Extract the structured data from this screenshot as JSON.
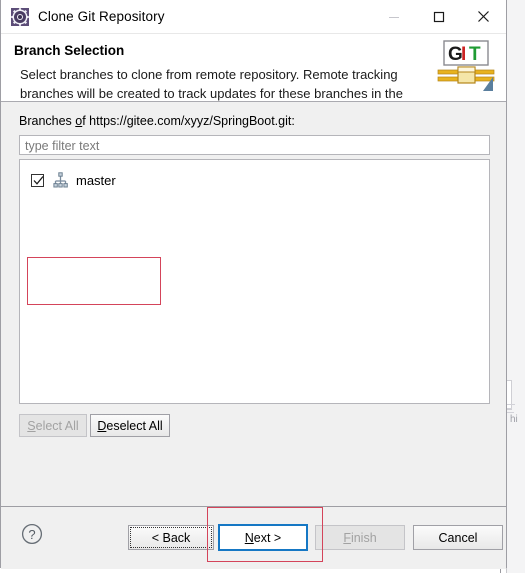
{
  "window": {
    "title": "Clone Git Repository",
    "app_icon": "gear-circle-icon",
    "controls": {
      "minimize": "minimize-icon",
      "maximize": "maximize-icon",
      "close": "close-icon"
    }
  },
  "header": {
    "title": "Branch Selection",
    "description": "Select branches to clone from remote repository. Remote tracking branches will be created to track updates for these branches in the",
    "logo": {
      "letters": [
        "G",
        "I",
        "T"
      ],
      "colors": {
        "g": "#1a1a1a",
        "i": "#cc2222",
        "t": "#1f9b33",
        "bar": "#e8b21e",
        "arrow": "#5a7f9e"
      }
    }
  },
  "main": {
    "branches_label_pre": "Branches ",
    "branches_label_mnemonic": "o",
    "branches_label_post": "f https://gitee.com/xyyz/SpringBoot.git:",
    "filter": {
      "value": "",
      "placeholder": "type filter text"
    },
    "branch_list": [
      {
        "label": "master",
        "checked": true,
        "icon": "git-branch-icon"
      }
    ],
    "select_all": {
      "mnemonic": "S",
      "rest": "elect All",
      "enabled": false
    },
    "deselect_all": {
      "mnemonic": "D",
      "rest": "eselect All",
      "enabled": true
    }
  },
  "footer": {
    "help_icon": "question-mark-icon",
    "back": {
      "label": "< Back",
      "enabled": true,
      "focused": true
    },
    "next": {
      "pre": "",
      "mnemonic": "N",
      "post": "ext >",
      "enabled": true,
      "default": true
    },
    "finish": {
      "mnemonic": "F",
      "rest": "inish",
      "enabled": false
    },
    "cancel": {
      "label": "Cancel",
      "enabled": true
    }
  },
  "annotations": {
    "branch_row_highlight_color": "#d4445a",
    "next_button_highlight_color": "#d4445a"
  },
  "background": {
    "ghost_text": "hi"
  }
}
